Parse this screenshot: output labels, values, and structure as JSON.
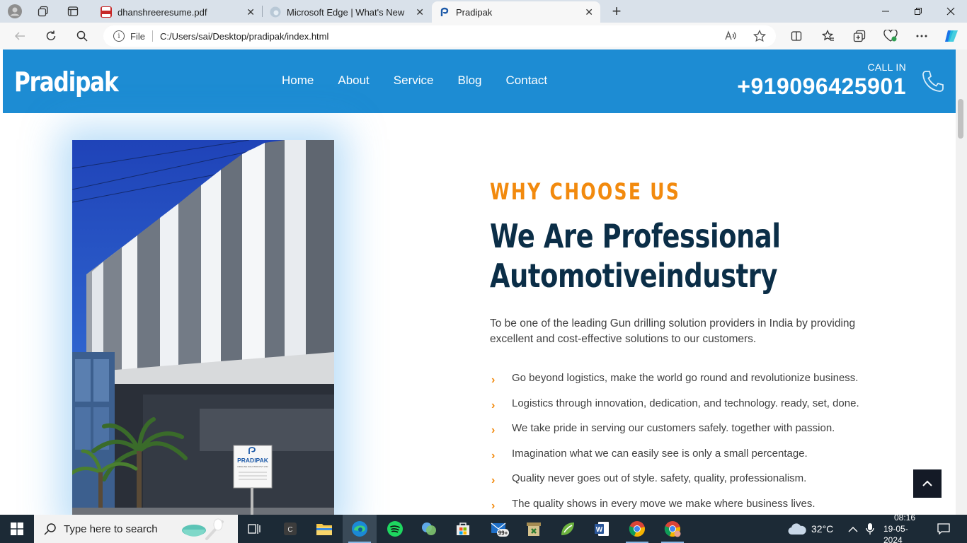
{
  "browser": {
    "tabs": [
      {
        "title": "dhanshreeresume.pdf",
        "favicon": "pdf-icon"
      },
      {
        "title": "Microsoft Edge | What's New",
        "favicon": "edge-icon"
      },
      {
        "title": "Pradipak",
        "favicon": "pradipak-logo-icon",
        "active": true
      }
    ],
    "new_tab_glyph": "+",
    "close_glyph": "✕",
    "address": {
      "scheme_label": "File",
      "url": "C:/Users/sai/Desktop/pradipak/index.html"
    }
  },
  "site": {
    "logo": "Pradipak",
    "nav": [
      "Home",
      "About",
      "Service",
      "Blog",
      "Contact"
    ],
    "call_label": "CALL IN",
    "call_number": "+919096425901",
    "sign": {
      "brand": "PRADIPAK",
      "subtitle": "DRILLING SOLUTION PVT LTD"
    },
    "why": {
      "subtitle": "WHY CHOOSE US",
      "headline_line1": "We Are Professional",
      "headline_line2": "Automotiveindustry",
      "intro": "To be one of the leading Gun drilling solution providers in India by providing excellent and cost-effective solutions to our customers.",
      "features": [
        "Go beyond logistics, make the world go round and revolutionize business.",
        "Logistics through innovation, dedication, and technology. ready, set, done.",
        "We take pride in serving our customers safely. together with passion.",
        "Imagination what we can easily see is only a small percentage.",
        "Quality never goes out of style. safety, quality, professionalism.",
        "The quality shows in every move we make where business lives."
      ]
    },
    "colors": {
      "nav_bg": "#1d8cd3",
      "accent": "#f28a0e",
      "heading": "#0b2e47"
    }
  },
  "taskbar": {
    "search_placeholder": "Type here to search",
    "weather": "32°C",
    "time": "08:16",
    "date": "19-05-2024",
    "mail_badge": "99+"
  }
}
